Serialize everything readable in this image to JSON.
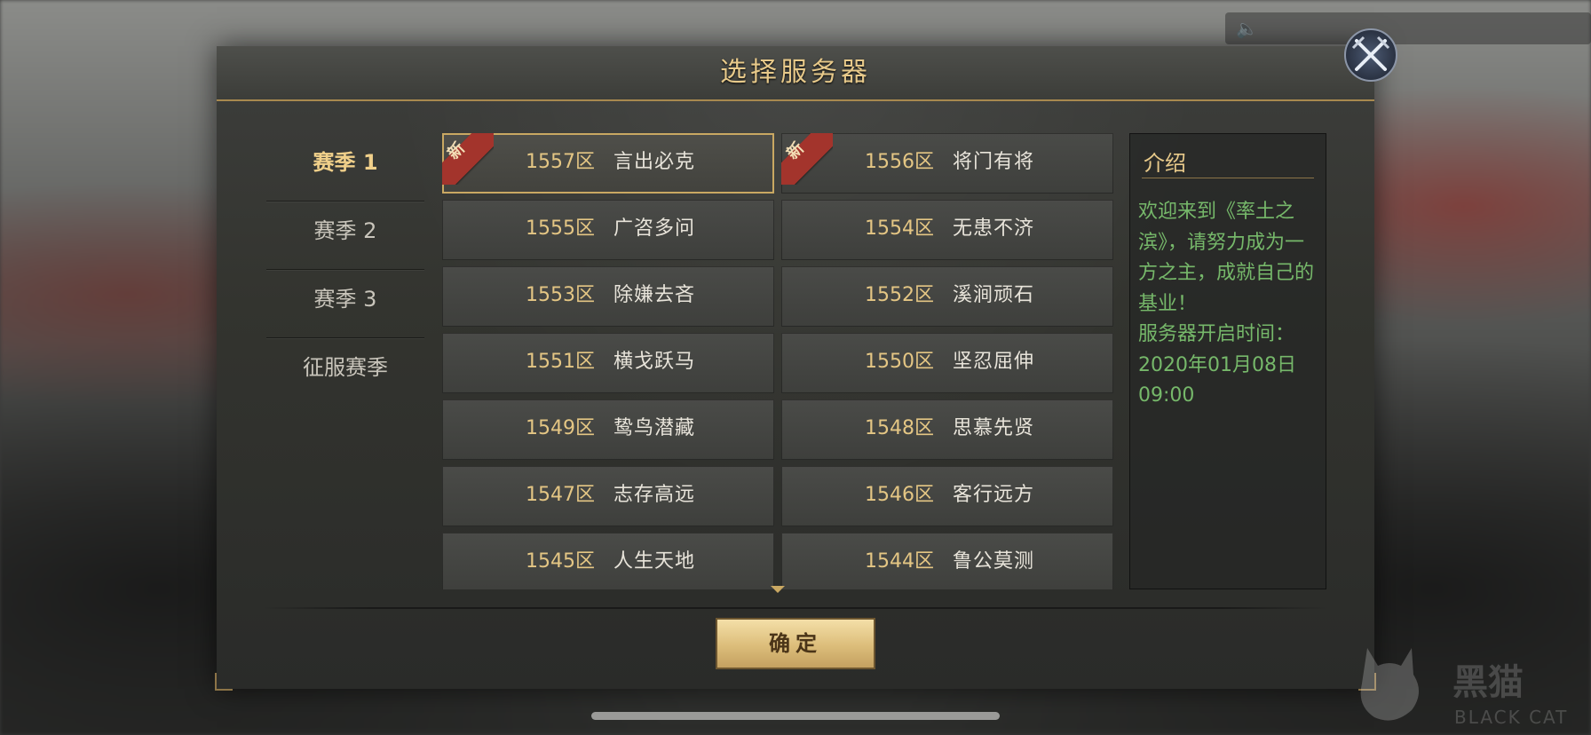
{
  "dialog": {
    "title": "选择服务器",
    "confirm_label": "确定"
  },
  "seasons": [
    {
      "label": "赛季 1",
      "active": true
    },
    {
      "label": "赛季 2",
      "active": false
    },
    {
      "label": "赛季 3",
      "active": false
    },
    {
      "label": "征服赛季",
      "active": false
    }
  ],
  "servers": [
    {
      "zone": "1557区",
      "name": "言出必克",
      "badge": "新",
      "selected": true
    },
    {
      "zone": "1556区",
      "name": "将门有将",
      "badge": "新",
      "selected": false
    },
    {
      "zone": "1555区",
      "name": "广咨多问",
      "badge": "",
      "selected": false
    },
    {
      "zone": "1554区",
      "name": "无患不济",
      "badge": "",
      "selected": false
    },
    {
      "zone": "1553区",
      "name": "除嫌去吝",
      "badge": "",
      "selected": false
    },
    {
      "zone": "1552区",
      "name": "溪涧顽石",
      "badge": "",
      "selected": false
    },
    {
      "zone": "1551区",
      "name": "横戈跃马",
      "badge": "",
      "selected": false
    },
    {
      "zone": "1550区",
      "name": "坚忍屈伸",
      "badge": "",
      "selected": false
    },
    {
      "zone": "1549区",
      "name": "鸷鸟潜藏",
      "badge": "",
      "selected": false
    },
    {
      "zone": "1548区",
      "name": "思慕先贤",
      "badge": "",
      "selected": false
    },
    {
      "zone": "1547区",
      "name": "志存高远",
      "badge": "",
      "selected": false
    },
    {
      "zone": "1546区",
      "name": "客行远方",
      "badge": "",
      "selected": false
    },
    {
      "zone": "1545区",
      "name": "人生天地",
      "badge": "",
      "selected": false
    },
    {
      "zone": "1544区",
      "name": "鲁公莫测",
      "badge": "",
      "selected": false
    }
  ],
  "intro": {
    "title": "介绍",
    "text": "欢迎来到《率土之滨》，请努力成为一方之主，成就自己的基业！",
    "open_time_label": "服务器开启时间：",
    "open_time": "2020年01月08日 09:00"
  },
  "watermark": {
    "text": "黑猫",
    "sub": "BLACK CAT"
  },
  "colors": {
    "accent_gold": "#e7c98a",
    "intro_green": "#76b86a",
    "badge_red": "#a3342c"
  },
  "icons": {
    "close": "crossed-swords-close-icon",
    "speaker": "speaker-icon"
  }
}
